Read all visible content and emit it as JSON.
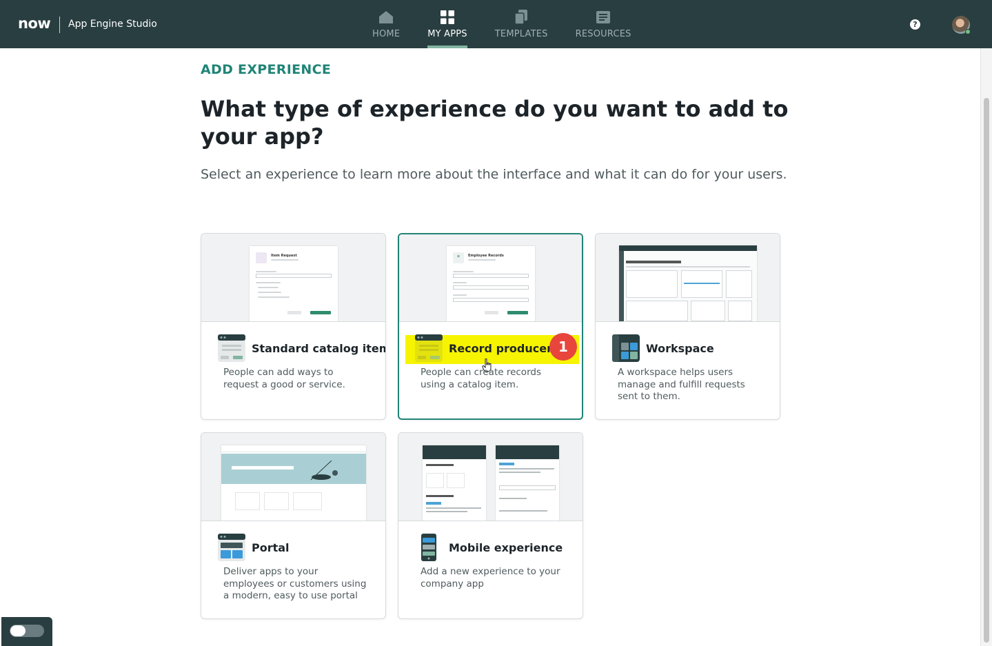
{
  "header": {
    "logo_text": "now",
    "app_name": "App Engine Studio",
    "nav": [
      {
        "label": "HOME",
        "icon": "home-icon",
        "active": false
      },
      {
        "label": "MY APPS",
        "icon": "grid-icon",
        "active": true
      },
      {
        "label": "TEMPLATES",
        "icon": "copy-icon",
        "active": false
      },
      {
        "label": "RESOURCES",
        "icon": "book-icon",
        "active": false
      }
    ],
    "help_label": "?"
  },
  "page": {
    "eyebrow": "ADD EXPERIENCE",
    "heading": "What type of experience do you want to add to your app?",
    "subheading": "Select an experience to learn more about the interface and what it can do for your users."
  },
  "cards": [
    {
      "title": "Standard catalog item",
      "description": "People can add ways to request a good or service.",
      "icon": "catalog-item-icon",
      "preview_title": "Item Request"
    },
    {
      "title": "Record producer",
      "description": "People can create records using a catalog item.",
      "icon": "record-producer-icon",
      "preview_title": "Employee Records",
      "selected": true,
      "step_badge": "1"
    },
    {
      "title": "Workspace",
      "description": "A workspace helps users manage and fulfill requests sent to them.",
      "icon": "workspace-icon"
    },
    {
      "title": "Portal",
      "description": "Deliver apps to your employees or customers using a modern, easy to use portal",
      "icon": "portal-icon"
    },
    {
      "title": "Mobile experience",
      "description": "Add a new experience to your company app",
      "icon": "mobile-icon"
    }
  ],
  "colors": {
    "nav_bg": "#293e40",
    "accent": "#1f8476",
    "highlight": "#f6f400",
    "badge": "#e8453c"
  }
}
